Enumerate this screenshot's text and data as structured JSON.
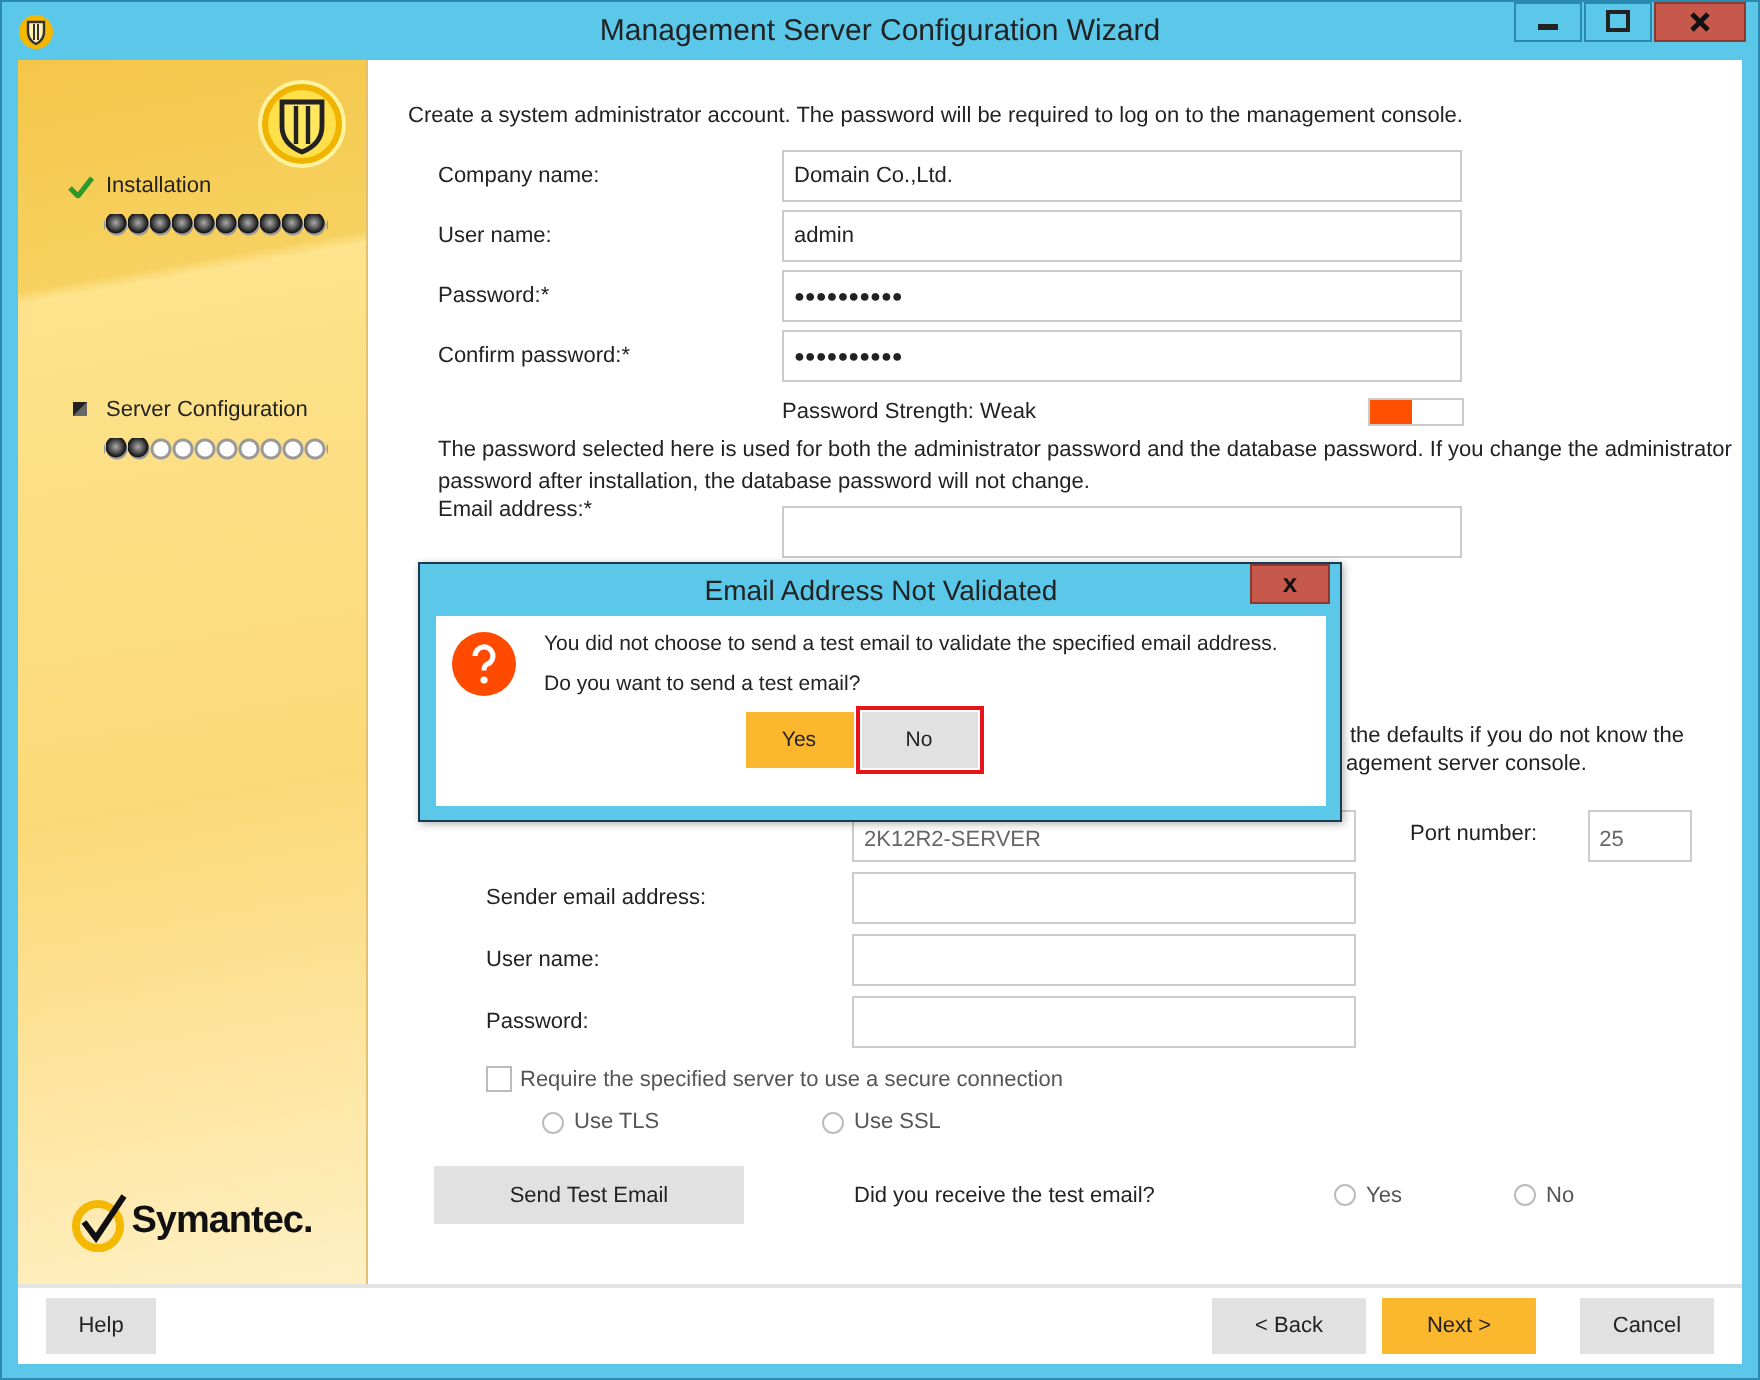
{
  "window": {
    "title": "Management Server Configuration Wizard"
  },
  "sidebar": {
    "steps": [
      {
        "label": "Installation",
        "done": true,
        "level": 1
      },
      {
        "label": "Server Configuration",
        "done": false,
        "level": 0.2
      }
    ],
    "brand": "Symantec."
  },
  "intro": "Create a system administrator account. The password will be required to log on to the management console.",
  "account_fields": [
    {
      "label": "Company name:",
      "value": "Domain Co.,Ltd.",
      "kind": "text"
    },
    {
      "label": "User name:",
      "value": "admin",
      "kind": "text"
    },
    {
      "label": "Password:*",
      "value": "●●●●●●●●●●",
      "kind": "password"
    },
    {
      "label": "Confirm password:*",
      "value": "●●●●●●●●●●",
      "kind": "password"
    }
  ],
  "strength": {
    "label": "Password Strength: Weak",
    "level": 0.45,
    "color": "#ff5000"
  },
  "note": "The password selected here is used for both the administrator password and the database password. If you change the administrator password after installation, the database password will not change.",
  "email_label": "Email address:*",
  "defaults_note_fragments": [
    "the defaults if you do not know the",
    "agement server console."
  ],
  "server": {
    "value": "2K12R2-SERVER",
    "port_label": "Port number:",
    "port_value": "25"
  },
  "mail_fields": [
    {
      "label": "Sender email address:"
    },
    {
      "label": "User name:"
    },
    {
      "label": "Password:"
    }
  ],
  "secure": {
    "label": "Require the specified server to use a secure connection",
    "checked": false
  },
  "protocols": [
    {
      "label": "Use TLS",
      "selected": false
    },
    {
      "label": "Use SSL",
      "selected": false
    }
  ],
  "test": {
    "button": "Send Test Email",
    "question": "Did you receive the test email?",
    "answers": [
      {
        "label": "Yes",
        "selected": false
      },
      {
        "label": "No",
        "selected": false
      }
    ]
  },
  "footer_buttons": [
    {
      "label": "Help",
      "kind": "normal"
    },
    {
      "label": "< Back",
      "kind": "normal"
    },
    {
      "label": "Next >",
      "kind": "primary"
    },
    {
      "label": "Cancel",
      "kind": "normal"
    }
  ],
  "dialog": {
    "title": "Email Address Not Validated",
    "close": "x",
    "message": [
      "You did not choose to send a test email to validate the specified email address.",
      "Do you want to send a test email?"
    ],
    "buttons": [
      {
        "label": "Yes",
        "kind": "primary",
        "focused": false
      },
      {
        "label": "No",
        "kind": "normal",
        "focused": true
      }
    ]
  }
}
